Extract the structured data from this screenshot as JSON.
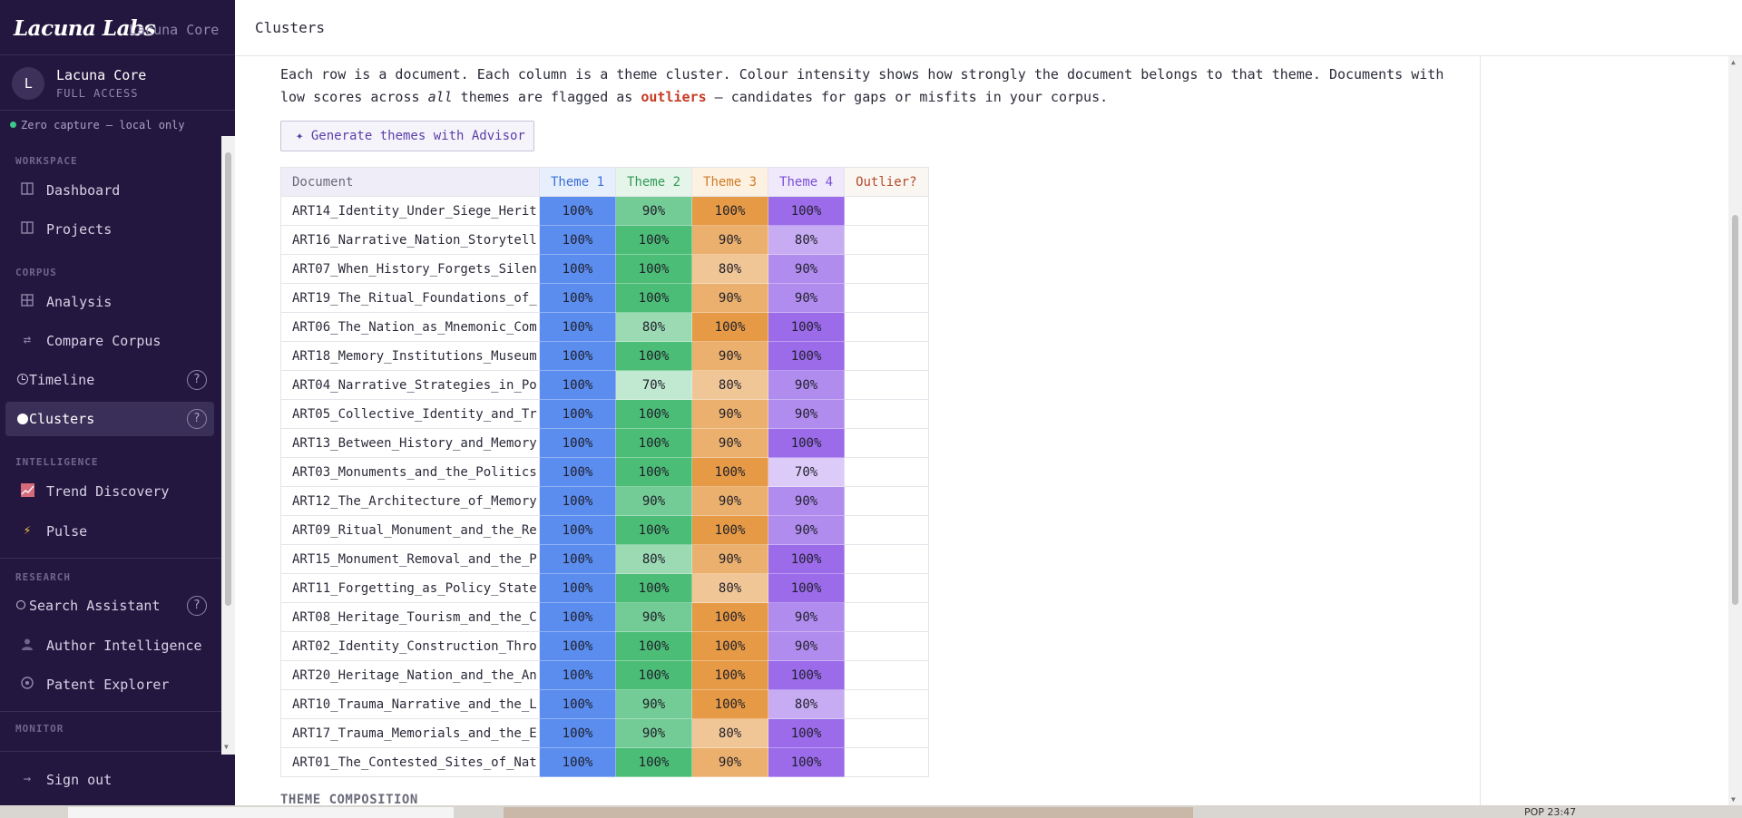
{
  "brand": {
    "logo": "Lacuna Labs",
    "product": "Lacuna Core"
  },
  "account": {
    "initial": "L",
    "name": "Lacuna Core",
    "role": "FULL ACCESS"
  },
  "capture_status": "Zero capture — local only",
  "nav": {
    "workspace_label": "WORKSPACE",
    "dashboard": "Dashboard",
    "projects": "Projects",
    "corpus_label": "CORPUS",
    "analysis": "Analysis",
    "compare_corpus": "Compare Corpus",
    "timeline": "Timeline",
    "clusters": "Clusters",
    "intelligence_label": "INTELLIGENCE",
    "trend_discovery": "Trend Discovery",
    "pulse": "Pulse",
    "research_label": "RESEARCH",
    "search_assistant": "Search Assistant",
    "author_intelligence": "Author Intelligence",
    "patent_explorer": "Patent Explorer",
    "monitor_label": "MONITOR",
    "sign_out": "Sign out",
    "help": "?"
  },
  "page": {
    "title": "Clusters",
    "intro_part1": "Each row is a document. Each column is a theme cluster. Colour intensity shows how strongly the document belongs to that theme. Documents with low scores across ",
    "intro_em": "all",
    "intro_part2": " themes are flagged as ",
    "intro_hl": "outliers",
    "intro_part3": " — candidates for gaps or misfits in your corpus.",
    "generate_button": "✦ Generate themes with Advisor",
    "section_theme_composition": "THEME COMPOSITION"
  },
  "matrix": {
    "headers": {
      "document": "Document",
      "theme1": "Theme 1",
      "theme2": "Theme 2",
      "theme3": "Theme 3",
      "theme4": "Theme 4",
      "outlier": "Outlier?"
    },
    "rows": [
      {
        "doc": "ART14_Identity_Under_Siege_Herit",
        "v": [
          100,
          90,
          100,
          100
        ]
      },
      {
        "doc": "ART16_Narrative_Nation_Storytell",
        "v": [
          100,
          100,
          90,
          80
        ]
      },
      {
        "doc": "ART07_When_History_Forgets_Silen",
        "v": [
          100,
          100,
          80,
          90
        ]
      },
      {
        "doc": "ART19_The_Ritual_Foundations_of_",
        "v": [
          100,
          100,
          90,
          90
        ]
      },
      {
        "doc": "ART06_The_Nation_as_Mnemonic_Com",
        "v": [
          100,
          80,
          100,
          100
        ]
      },
      {
        "doc": "ART18_Memory_Institutions_Museum",
        "v": [
          100,
          100,
          90,
          100
        ]
      },
      {
        "doc": "ART04_Narrative_Strategies_in_Po",
        "v": [
          100,
          70,
          80,
          90
        ]
      },
      {
        "doc": "ART05_Collective_Identity_and_Tr",
        "v": [
          100,
          100,
          90,
          90
        ]
      },
      {
        "doc": "ART13_Between_History_and_Memory",
        "v": [
          100,
          100,
          90,
          100
        ]
      },
      {
        "doc": "ART03_Monuments_and_the_Politics",
        "v": [
          100,
          100,
          100,
          70
        ]
      },
      {
        "doc": "ART12_The_Architecture_of_Memory",
        "v": [
          100,
          90,
          90,
          90
        ]
      },
      {
        "doc": "ART09_Ritual_Monument_and_the_Re",
        "v": [
          100,
          100,
          100,
          90
        ]
      },
      {
        "doc": "ART15_Monument_Removal_and_the_P",
        "v": [
          100,
          80,
          90,
          100
        ]
      },
      {
        "doc": "ART11_Forgetting_as_Policy_State",
        "v": [
          100,
          100,
          80,
          100
        ]
      },
      {
        "doc": "ART08_Heritage_Tourism_and_the_C",
        "v": [
          100,
          90,
          100,
          90
        ]
      },
      {
        "doc": "ART02_Identity_Construction_Thro",
        "v": [
          100,
          100,
          100,
          90
        ]
      },
      {
        "doc": "ART20_Heritage_Nation_and_the_An",
        "v": [
          100,
          100,
          100,
          100
        ]
      },
      {
        "doc": "ART10_Trauma_Narrative_and_the_L",
        "v": [
          100,
          90,
          100,
          80
        ]
      },
      {
        "doc": "ART17_Trauma_Memorials_and_the_E",
        "v": [
          100,
          90,
          80,
          100
        ]
      },
      {
        "doc": "ART01_The_Contested_Sites_of_Nat",
        "v": [
          100,
          100,
          90,
          100
        ]
      }
    ],
    "theme_colors": [
      "#5b8def",
      "#4cbd77",
      "#e69a45",
      "#9b6bea"
    ],
    "unit": "%"
  },
  "taskbar": {
    "clock": "POP   23:47"
  }
}
